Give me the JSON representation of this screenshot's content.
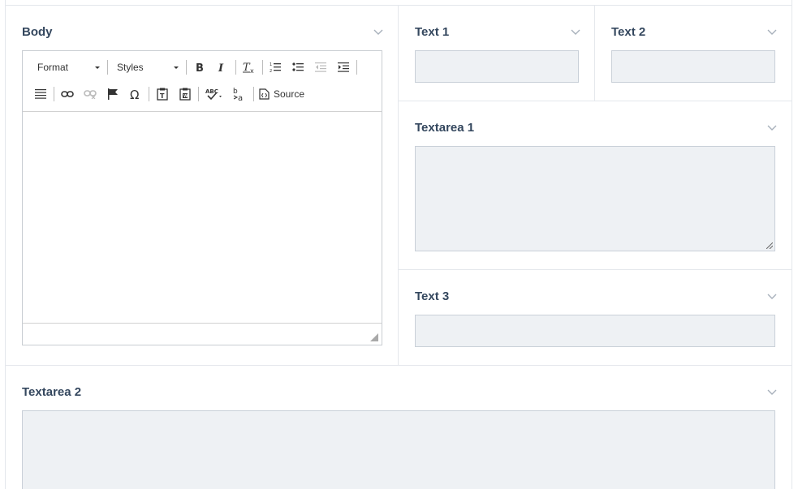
{
  "fields": {
    "body": {
      "label": "Body"
    },
    "text1": {
      "label": "Text 1",
      "value": ""
    },
    "text2": {
      "label": "Text 2",
      "value": ""
    },
    "textarea1": {
      "label": "Textarea 1",
      "value": ""
    },
    "text3": {
      "label": "Text 3",
      "value": ""
    },
    "textarea2": {
      "label": "Textarea 2",
      "value": ""
    }
  },
  "editor": {
    "format_label": "Format",
    "styles_label": "Styles",
    "source_label": "Source",
    "buttons": [
      "bold",
      "italic",
      "remove-format",
      "numbered-list",
      "bulleted-list",
      "outdent",
      "indent",
      "blockquote",
      "link",
      "unlink",
      "anchor",
      "special-char",
      "paste-text",
      "paste-word",
      "spellcheck",
      "find-replace",
      "source"
    ]
  },
  "colors": {
    "border": "#e4e7ec",
    "input_bg": "#eef1f4",
    "label": "#34475e"
  }
}
